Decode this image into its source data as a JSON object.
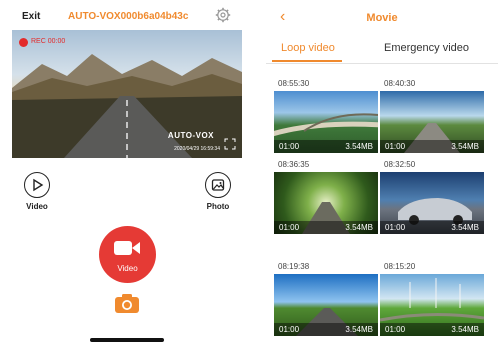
{
  "left": {
    "exit_label": "Exit",
    "device_name": "AUTO-VOX000b6a04b43c",
    "icons": {
      "settings": "gear-icon",
      "fullscreen": "fullscreen-icon",
      "video": "play-circle-icon",
      "photo": "gallery-icon",
      "record": "video-camera-icon",
      "snapshot": "camera-icon"
    },
    "live": {
      "rec_text": "REC 00:00",
      "brand": "AUTO-VOX",
      "timestamp": "2020/04/29  16:59:34"
    },
    "video_label": "Video",
    "photo_label": "Photo",
    "record_label": "Video",
    "accent_color": "#f08a2e",
    "record_color": "#e53a35"
  },
  "right": {
    "title": "Movie",
    "tabs": [
      {
        "label": "Loop video",
        "active": true
      },
      {
        "label": "Emergency video",
        "active": false
      }
    ],
    "videos": [
      {
        "time": "08:55:30",
        "duration": "01:00",
        "size": "3.54MB"
      },
      {
        "time": "08:40:30",
        "duration": "01:00",
        "size": "3.54MB"
      },
      {
        "time": "08:36:35",
        "duration": "01:00",
        "size": "3.54MB"
      },
      {
        "time": "08:32:50",
        "duration": "01:00",
        "size": "3.54MB"
      },
      {
        "time": "08:19:38",
        "duration": "01:00",
        "size": "3.54MB"
      },
      {
        "time": "08:15:20",
        "duration": "01:00",
        "size": "3.54MB"
      }
    ]
  }
}
